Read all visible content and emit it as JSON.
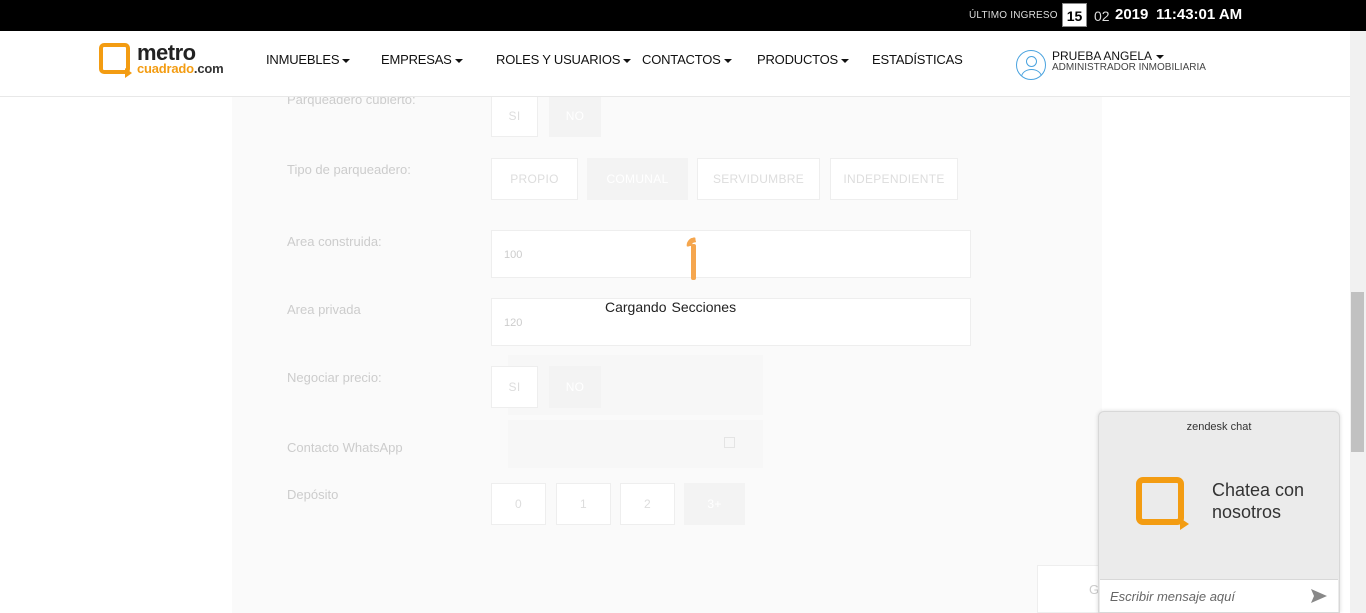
{
  "topbar": {
    "last_login_label": "ÚLTIMO INGRESO",
    "day": "15",
    "month": "02",
    "year": "2019",
    "time": "11:43:01 AM"
  },
  "header": {
    "logo_top": "metro",
    "logo_bottom_main": "cuadrado",
    "logo_bottom_suffix": ".com",
    "nav": [
      "INMUEBLES",
      "EMPRESAS",
      "ROLES Y USUARIOS",
      "CONTACTOS",
      "PRODUCTOS",
      "ESTADÍSTICAS"
    ],
    "user_name": "PRUEBA ANGELA",
    "user_role": "ADMINISTRADOR INMOBILIARIA"
  },
  "form": {
    "parking_covered": {
      "label": "Parqueadero cubierto:",
      "options": [
        "SI",
        "NO"
      ],
      "selected": "NO"
    },
    "parking_type": {
      "label": "Tipo de parqueadero:",
      "options": [
        "PROPIO",
        "COMUNAL",
        "SERVIDUMBRE",
        "INDEPENDIENTE"
      ],
      "selected": "COMUNAL"
    },
    "built_area": {
      "label": "Area construida:",
      "value": "100"
    },
    "private_area": {
      "label": "Area privada",
      "value": "120"
    },
    "negotiate_price": {
      "label": "Negociar precio:",
      "options": [
        "SI",
        "NO"
      ],
      "selected": "NO"
    },
    "whatsapp": {
      "label": "Contacto WhatsApp"
    },
    "deposit": {
      "label": "Depósito",
      "options": [
        "0",
        "1",
        "2",
        "3+"
      ],
      "selected": "3+"
    },
    "save_label": "Guardar"
  },
  "loader": {
    "word1": "Cargando",
    "word2": "Secciones"
  },
  "chat": {
    "brand": "zendesk chat",
    "cta": "Chatea con nosotros",
    "placeholder": "Escribir mensaje aquí"
  },
  "colors": {
    "brand_orange": "#f39c12",
    "spinner": "#f5a64e"
  }
}
